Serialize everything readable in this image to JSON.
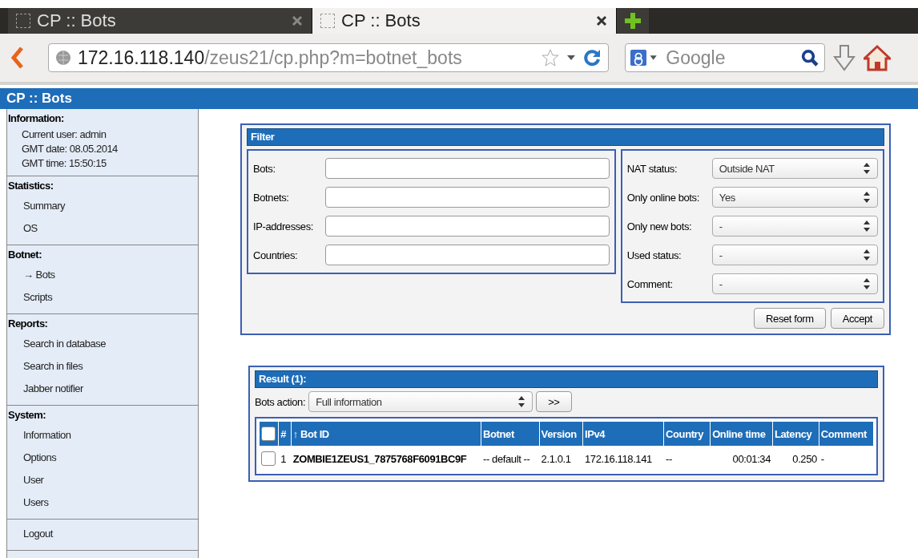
{
  "browser": {
    "tabs": [
      {
        "title": "CP :: Bots",
        "selected": false
      },
      {
        "title": "CP :: Bots",
        "selected": true
      }
    ],
    "address": {
      "host": "172.16.118.140",
      "path": "/zeus21/cp.php?m=botnet_bots"
    },
    "search": {
      "placeholder": "Google"
    }
  },
  "page": {
    "title": "CP :: Bots"
  },
  "sidebar": {
    "sections": [
      {
        "heading": "Information:",
        "kind": "info",
        "items": [
          {
            "label": "Current user: admin"
          },
          {
            "label": "GMT date: 08.05.2014"
          },
          {
            "label": "GMT time: 15:50:15"
          }
        ]
      },
      {
        "heading": "Statistics:",
        "kind": "menu",
        "items": [
          {
            "label": "Summary"
          },
          {
            "label": "OS"
          }
        ]
      },
      {
        "heading": "Botnet:",
        "kind": "menu",
        "items": [
          {
            "label": "→ Bots"
          },
          {
            "label": "Scripts"
          }
        ]
      },
      {
        "heading": "Reports:",
        "kind": "menu",
        "items": [
          {
            "label": "Search in database"
          },
          {
            "label": "Search in files"
          },
          {
            "label": "Jabber notifier"
          }
        ]
      },
      {
        "heading": "System:",
        "kind": "menu",
        "items": [
          {
            "label": "Information"
          },
          {
            "label": "Options"
          },
          {
            "label": "User"
          },
          {
            "label": "Users"
          }
        ]
      },
      {
        "kind": "menu",
        "items": [
          {
            "label": "Logout"
          }
        ]
      }
    ]
  },
  "filter": {
    "title": "Filter",
    "text_fields": [
      {
        "label": "Bots:"
      },
      {
        "label": "Botnets:"
      },
      {
        "label": "IP-addresses:"
      },
      {
        "label": "Countries:"
      }
    ],
    "selects": [
      {
        "label": "NAT status:",
        "value": "Outside NAT"
      },
      {
        "label": "Only online bots:",
        "value": "Yes"
      },
      {
        "label": "Only new bots:",
        "value": "-"
      },
      {
        "label": "Used status:",
        "value": "-"
      },
      {
        "label": "Comment:",
        "value": "-"
      }
    ],
    "buttons": [
      "Reset form",
      "Accept"
    ]
  },
  "result": {
    "title": "Result (1):",
    "bots_action": {
      "label": "Bots action:",
      "value": "Full information"
    },
    "go_button": ">>",
    "table": {
      "header_checked": false,
      "columns": [
        "#",
        "↑ Bot ID",
        "Botnet",
        "Version",
        "IPv4",
        "Country",
        "Online time",
        "Latency",
        "Comment"
      ],
      "rows": [
        {
          "checked": false,
          "cells": [
            "1",
            "ZOMBIE1ZEUS1_7875768F6091BC9F",
            "-- default --",
            "2.1.0.1",
            "172.16.118.141",
            "--",
            "00:01:34",
            "0.250",
            "-"
          ]
        }
      ]
    }
  }
}
